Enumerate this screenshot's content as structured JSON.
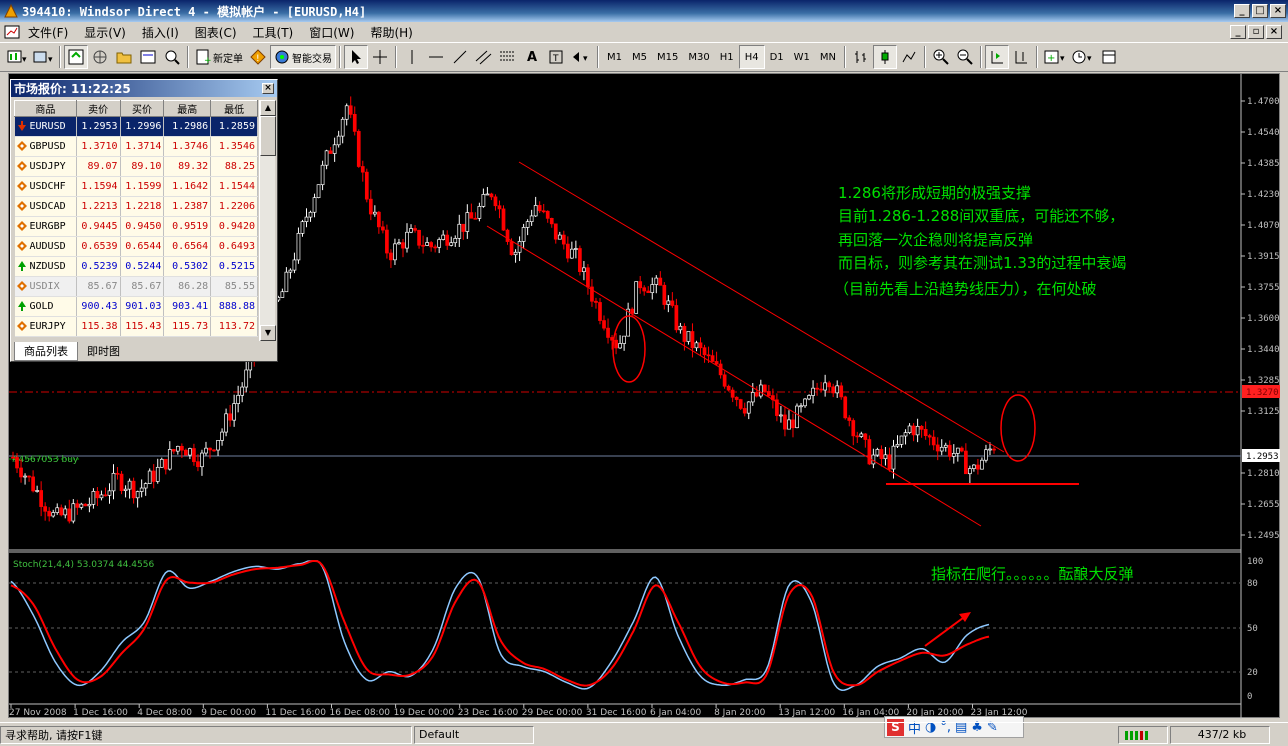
{
  "window": {
    "title": "394410: Windsor Direct 4 - 模拟帐户 - [EURUSD,H4]"
  },
  "menu": [
    "文件(F)",
    "显示(V)",
    "插入(I)",
    "图表(C)",
    "工具(T)",
    "窗口(W)",
    "帮助(H)"
  ],
  "toolbar": {
    "new_order_label": "新定单",
    "expert_label": "智能交易",
    "text_tool": "A",
    "timeframes": [
      "M1",
      "M5",
      "M15",
      "M30",
      "H1",
      "H4",
      "D1",
      "W1",
      "MN"
    ],
    "active_timeframe": "H4"
  },
  "market_watch": {
    "title": "市场报价: 11:22:25",
    "columns": [
      "商品",
      "卖价",
      "买价",
      "最高",
      "最低"
    ],
    "rows": [
      {
        "symbol": "EURUSD",
        "bid": "1.2953",
        "ask": "1.2996",
        "high": "1.2986",
        "low": "1.2859",
        "dir": "down",
        "selected": true
      },
      {
        "symbol": "GBPUSD",
        "bid": "1.3710",
        "ask": "1.3714",
        "high": "1.3746",
        "low": "1.3546",
        "dir": "diamond"
      },
      {
        "symbol": "USDJPY",
        "bid": "89.07",
        "ask": "89.10",
        "high": "89.32",
        "low": "88.25",
        "dir": "diamond"
      },
      {
        "symbol": "USDCHF",
        "bid": "1.1594",
        "ask": "1.1599",
        "high": "1.1642",
        "low": "1.1544",
        "dir": "diamond"
      },
      {
        "symbol": "USDCAD",
        "bid": "1.2213",
        "ask": "1.2218",
        "high": "1.2387",
        "low": "1.2206",
        "dir": "diamond"
      },
      {
        "symbol": "EURGBP",
        "bid": "0.9445",
        "ask": "0.9450",
        "high": "0.9519",
        "low": "0.9420",
        "dir": "diamond"
      },
      {
        "symbol": "AUDUSD",
        "bid": "0.6539",
        "ask": "0.6544",
        "high": "0.6564",
        "low": "0.6493",
        "dir": "diamond"
      },
      {
        "symbol": "NZDUSD",
        "bid": "0.5239",
        "ask": "0.5244",
        "high": "0.5302",
        "low": "0.5215",
        "dir": "up",
        "blue": true
      },
      {
        "symbol": "USDIX",
        "bid": "85.67",
        "ask": "85.67",
        "high": "86.28",
        "low": "85.55",
        "dir": "diamond",
        "grey": true
      },
      {
        "symbol": "GOLD",
        "bid": "900.43",
        "ask": "901.03",
        "high": "903.41",
        "low": "888.88",
        "dir": "up",
        "blue": true
      },
      {
        "symbol": "EURJPY",
        "bid": "115.38",
        "ask": "115.43",
        "high": "115.73",
        "low": "113.72",
        "dir": "diamond"
      }
    ],
    "tabs": [
      "商品列表",
      "即时图"
    ]
  },
  "chart": {
    "price_scale": [
      "1.4700",
      "1.4540",
      "1.4385",
      "1.4230",
      "1.4070",
      "1.3915",
      "1.3755",
      "1.3600",
      "1.3440",
      "1.3285",
      "1.3125",
      "1.2953",
      "1.2810",
      "1.2655",
      "1.2495"
    ],
    "highlighted_price": "1.3270",
    "bid_price": "1.2953",
    "order_label": "#4567053 buy",
    "annotation_lines": [
      "1.286将形成短期的极强支撑",
      "目前1.286-1.288间双重底，可能还不够，",
      "再回落一次企稳则将提高反弹",
      "而目标，则参考其在测试1.33的过程中衰竭",
      "（目前先看上沿趋势线压力），在何处破"
    ],
    "indicator_label": "Stoch(21,4,4) 53.0374 44.4556",
    "indicator_scale": [
      "100",
      "80",
      "50",
      "20",
      "0"
    ],
    "indicator_annotation": "指标在爬行。。。。。。酝酿大反弹",
    "time_labels": [
      "27 Nov 2008",
      "1 Dec 16:00",
      "4 Dec 08:00",
      "9 Dec 00:00",
      "11 Dec 16:00",
      "16 Dec 08:00",
      "19 Dec 00:00",
      "23 Dec 16:00",
      "29 Dec 00:00",
      "31 Dec 16:00",
      "6 Jan 04:00",
      "8 Jan 20:00",
      "13 Jan 12:00",
      "16 Jan 04:00",
      "20 Jan 20:00",
      "23 Jan 12:00"
    ],
    "colors": {
      "up_candle": "#ffffff",
      "down_candle": "#ff0000",
      "annotation": "#00e000",
      "trendline": "#ff0000",
      "k_line": "#8ec8ff",
      "d_line": "#ff0000"
    },
    "price_path": [
      1.289,
      1.274,
      1.258,
      1.262,
      1.268,
      1.278,
      1.272,
      1.283,
      1.296,
      1.288,
      1.302,
      1.326,
      1.352,
      1.375,
      1.41,
      1.44,
      1.468,
      1.42,
      1.392,
      1.402,
      1.396,
      1.403,
      1.41,
      1.425,
      1.392,
      1.418,
      1.402,
      1.39,
      1.365,
      1.345,
      1.378,
      1.375,
      1.352,
      1.342,
      1.33,
      1.315,
      1.323,
      1.304,
      1.315,
      1.332,
      1.31,
      1.29,
      1.287,
      1.305,
      1.298,
      1.292,
      1.282,
      1.2953
    ],
    "stoch_k": [
      85,
      60,
      25,
      8,
      18,
      40,
      55,
      92,
      80,
      85,
      92,
      96,
      94,
      98,
      96,
      40,
      12,
      18,
      15,
      35,
      80,
      88,
      32,
      22,
      18,
      10,
      6,
      25,
      55,
      88,
      45,
      15,
      8,
      12,
      20,
      82,
      70,
      10,
      8,
      22,
      28,
      35,
      25,
      45,
      53
    ],
    "stoch_d": [
      82,
      68,
      35,
      12,
      14,
      32,
      50,
      86,
      84,
      84,
      90,
      94,
      95,
      97,
      97,
      55,
      20,
      16,
      16,
      30,
      70,
      85,
      42,
      25,
      20,
      12,
      8,
      20,
      48,
      82,
      55,
      22,
      10,
      10,
      16,
      75,
      75,
      18,
      8,
      18,
      26,
      32,
      30,
      38,
      44
    ]
  },
  "statusbar": {
    "help": "寻求帮助, 请按F1键",
    "profile": "Default",
    "traffic": "437/2 kb"
  },
  "ime": {
    "label": "中"
  }
}
